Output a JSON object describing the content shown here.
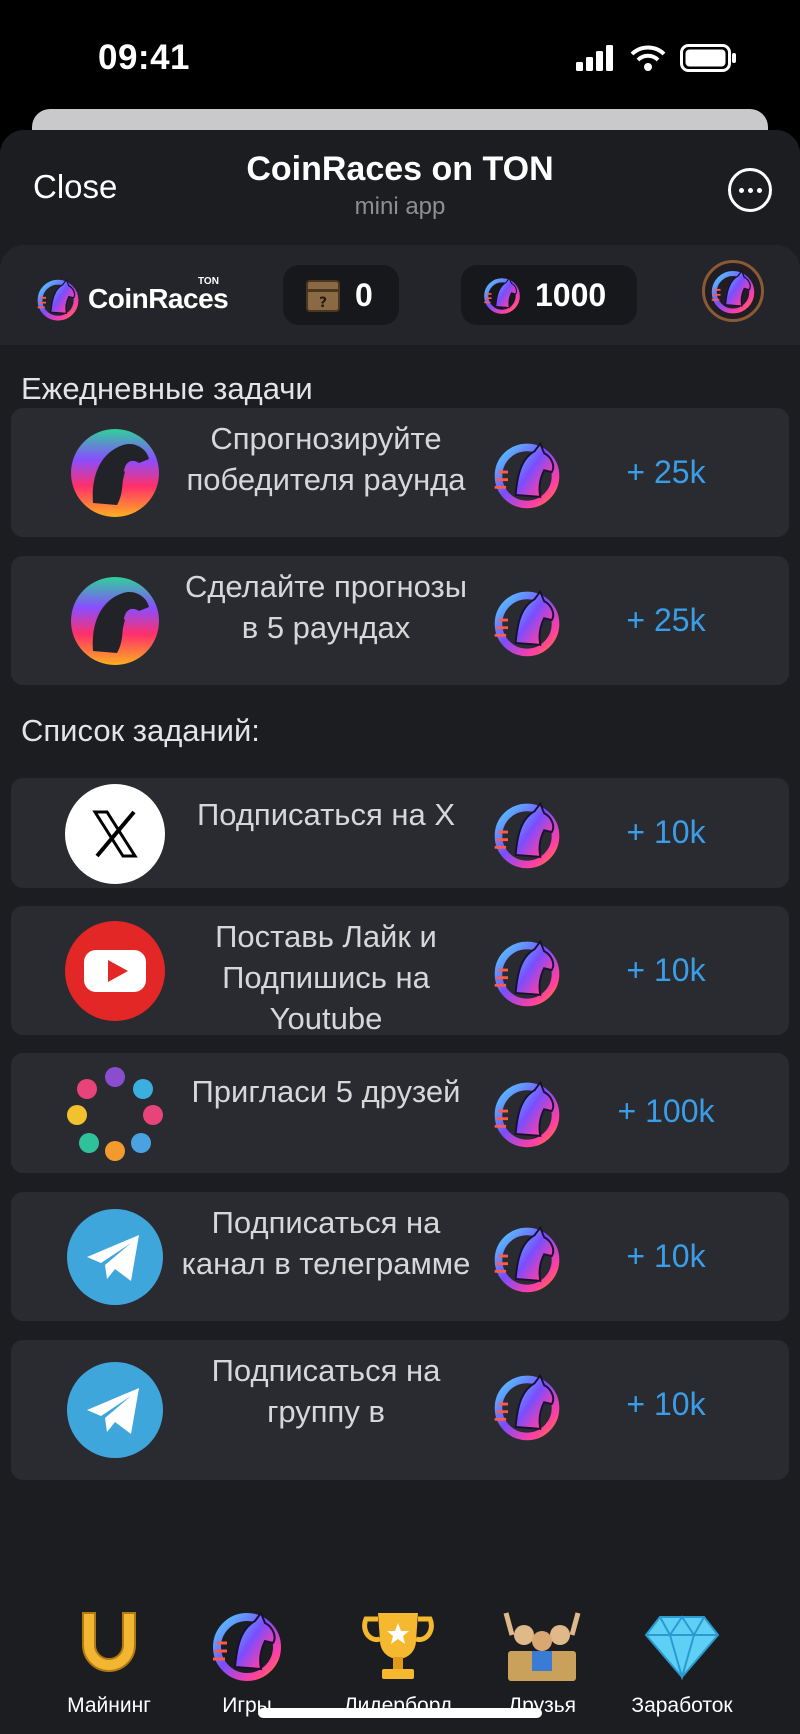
{
  "status_bar": {
    "time": "09:41"
  },
  "top_bar": {
    "close_label": "Close",
    "title": "CoinRaces on TON",
    "subtitle": "mini app"
  },
  "header": {
    "logo_text": "CoinRaces",
    "logo_tag": "TON",
    "chest_count": "0",
    "coin_balance": "1000"
  },
  "daily": {
    "title": "Ежедневные задачи",
    "tasks": [
      {
        "text": "Спрогнозируйте победителя раунда",
        "reward": "+ 25k",
        "icon": "raven-icon"
      },
      {
        "text": "Сделайте прогнозы в 5 раундах",
        "reward": "+ 25k",
        "icon": "raven-icon"
      }
    ]
  },
  "tasks": {
    "title": "Список заданий:",
    "items": [
      {
        "text": "Подписаться на X",
        "reward": "+ 10k",
        "icon": "x-logo-icon"
      },
      {
        "text": "Поставь Лайк и Подпишись на Youtube",
        "reward": "+ 10k",
        "icon": "youtube-icon"
      },
      {
        "text": "Пригласи 5 друзей",
        "reward": "+ 100k",
        "icon": "friends-circle-icon"
      },
      {
        "text": "Подписаться на канал в телеграмме",
        "reward": "+ 10k",
        "icon": "telegram-icon"
      },
      {
        "text": "Подписаться на группу в",
        "reward": "+ 10k",
        "icon": "telegram-icon"
      }
    ]
  },
  "nav": {
    "items": [
      {
        "label": "Майнинг",
        "icon": "horseshoe-icon"
      },
      {
        "label": "Игры",
        "icon": "horse-coin-icon"
      },
      {
        "label": "Лидерборд",
        "icon": "trophy-icon"
      },
      {
        "label": "Друзья",
        "icon": "fans-icon"
      },
      {
        "label": "Заработок",
        "icon": "diamond-icon"
      }
    ]
  },
  "colors": {
    "accent": "#3a9de8",
    "card": "#2a2b30",
    "background": "#1c1d21"
  }
}
